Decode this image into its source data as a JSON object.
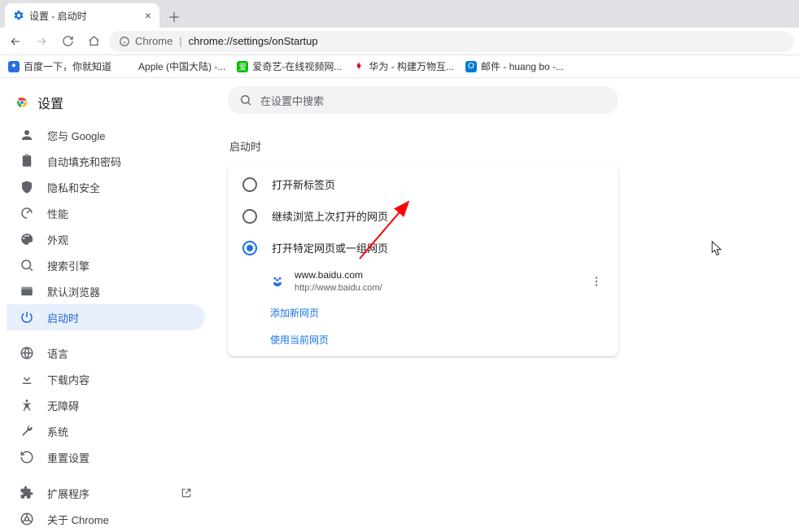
{
  "tab": {
    "title": "设置 - 启动时"
  },
  "addressbar": {
    "scheme": "Chrome",
    "url": "chrome://settings/onStartup"
  },
  "bookmarks": [
    {
      "label": "百度一下，你就知道",
      "color": "#2a6de1"
    },
    {
      "label": "Apple (中国大陆) -...",
      "color": "#999"
    },
    {
      "label": "爱奇艺-在线视频网...",
      "color": "#00be06"
    },
    {
      "label": "华为 - 构建万物互...",
      "color": "#e4002b"
    },
    {
      "label": "邮件 - huang bo -...",
      "color": "#0078d4"
    }
  ],
  "sidebar": {
    "title": "设置",
    "items": [
      {
        "label": "您与 Google"
      },
      {
        "label": "自动填充和密码"
      },
      {
        "label": "隐私和安全"
      },
      {
        "label": "性能"
      },
      {
        "label": "外观"
      },
      {
        "label": "搜索引擎"
      },
      {
        "label": "默认浏览器"
      },
      {
        "label": "启动时"
      }
    ],
    "items2": [
      {
        "label": "语言"
      },
      {
        "label": "下载内容"
      },
      {
        "label": "无障碍"
      },
      {
        "label": "系统"
      },
      {
        "label": "重置设置"
      }
    ],
    "items3": [
      {
        "label": "扩展程序"
      },
      {
        "label": "关于 Chrome"
      }
    ]
  },
  "search": {
    "placeholder": "在设置中搜索"
  },
  "section": {
    "title": "启动时",
    "options": [
      "打开新标签页",
      "继续浏览上次打开的网页",
      "打开特定网页或一组网页"
    ],
    "startup_page": {
      "title": "www.baidu.com",
      "url": "http://www.baidu.com/"
    },
    "add_link": "添加新网页",
    "use_current": "使用当前网页"
  }
}
